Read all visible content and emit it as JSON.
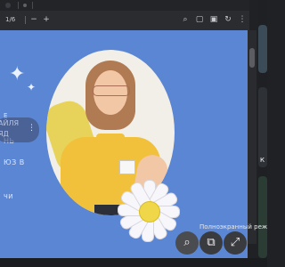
{
  "toolbar": {
    "page_counter": "1/6",
    "zoom_out_icon": "minus",
    "zoom_in_icon": "plus",
    "right_icons": [
      "search-icon",
      "copy-icon",
      "present-icon",
      "rotate-icon",
      "more-icon"
    ]
  },
  "slide": {
    "text_lines": [
      "Е",
      "НЬ",
      "ЮЗ В",
      "ЧИ"
    ],
    "overlay_text": [
      "АЙЛЯ",
      "ЯД"
    ],
    "overlay_more": "⋮"
  },
  "presentation_controls": {
    "tooltip": "Полноэкранный режим",
    "buttons": [
      {
        "name": "zoom-icon",
        "glyph": "⌕"
      },
      {
        "name": "open-in-new-icon",
        "glyph": "⧉"
      },
      {
        "name": "fullscreen-icon",
        "glyph": "⤢"
      }
    ]
  },
  "side_panel": {
    "tile2_label": "К"
  },
  "colors": {
    "slide_bg": "#5b86d3",
    "shirt": "#f2c13b",
    "chrome": "#2b2c30"
  }
}
